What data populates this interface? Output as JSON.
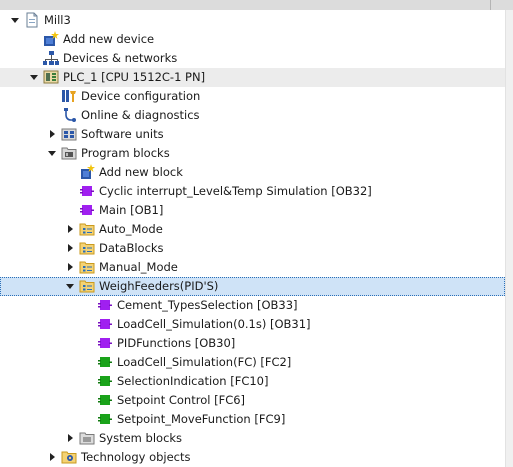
{
  "tree": {
    "project_label": "Mill3",
    "add_new_device": "Add new device",
    "devices_networks": "Devices & networks",
    "plc_label": "PLC_1 [CPU 1512C-1 PN]",
    "device_configuration": "Device configuration",
    "online_diagnostics": "Online & diagnostics",
    "software_units": "Software units",
    "program_blocks": "Program blocks",
    "add_new_block": "Add new block",
    "cyclic_interrupt": "Cyclic interrupt_Level&Temp Simulation [OB32]",
    "main": "Main [OB1]",
    "auto_mode": "Auto_Mode",
    "datablocks": "DataBlocks",
    "manual_mode": "Manual_Mode",
    "weighfeeders": "WeighFeeders(PID'S)",
    "cement_types": "Cement_TypesSelection [OB33]",
    "loadcell_sim_ob": "LoadCell_Simulation(0.1s) [OB31]",
    "pid_functions": "PIDFunctions [OB30]",
    "loadcell_sim_fc": "LoadCell_Simulation(FC) [FC2]",
    "selection_indication": "SelectionIndication [FC10]",
    "setpoint_control": "Setpoint Control [FC6]",
    "setpoint_move": "Setpoint_MoveFunction [FC9]",
    "system_blocks": "System blocks",
    "technology_objects": "Technology objects"
  },
  "colors": {
    "ob_block": "#a020f0",
    "fc_block": "#1aa31a",
    "folder": "#e7b73a",
    "selection": "#cfe3f7"
  },
  "icons": {
    "expanded": "triangle-down-icon",
    "collapsed": "triangle-right-icon"
  }
}
